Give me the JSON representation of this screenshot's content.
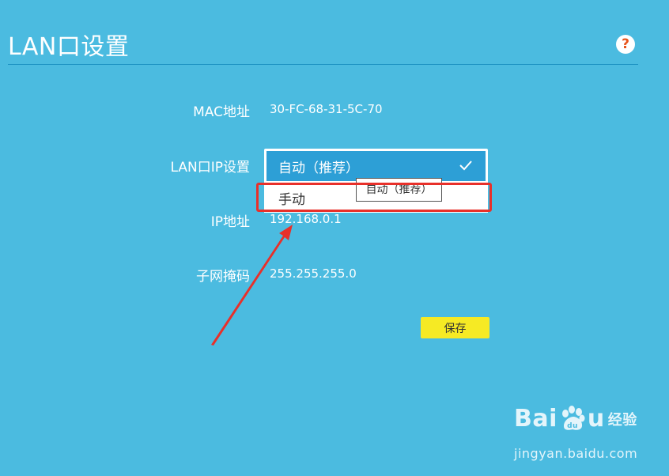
{
  "page": {
    "title": "LAN口设置",
    "help_icon": "question-circle-icon",
    "help_glyph": "?"
  },
  "fields": {
    "mac_label": "MAC地址",
    "mac_value": "30-FC-68-31-5C-70",
    "lan_ip_label": "LAN口IP设置",
    "ip_label": "IP地址",
    "ip_value": "192.168.0.1",
    "subnet_label": "子网掩码",
    "subnet_value": "255.255.255.0"
  },
  "dropdown": {
    "selected": "自动（推荐）",
    "options": [
      "自动（推荐）",
      "手动"
    ],
    "tooltip": "自动（推荐）",
    "check_icon": "check-icon"
  },
  "actions": {
    "save_label": "保存"
  },
  "annotation": {
    "highlight_color": "#e8302a",
    "arrow_icon": "red-arrow-icon"
  },
  "watermark": {
    "brand_left": "Bai",
    "brand_right": "u",
    "brand_sub": "经验",
    "url": "jingyan.baidu.com",
    "paw_icon": "baidu-paw-icon"
  },
  "colors": {
    "background": "#4bbbe0",
    "selected_option": "#2d9fd6",
    "save_button": "#f6ea24",
    "help_question": "#e8541c"
  }
}
